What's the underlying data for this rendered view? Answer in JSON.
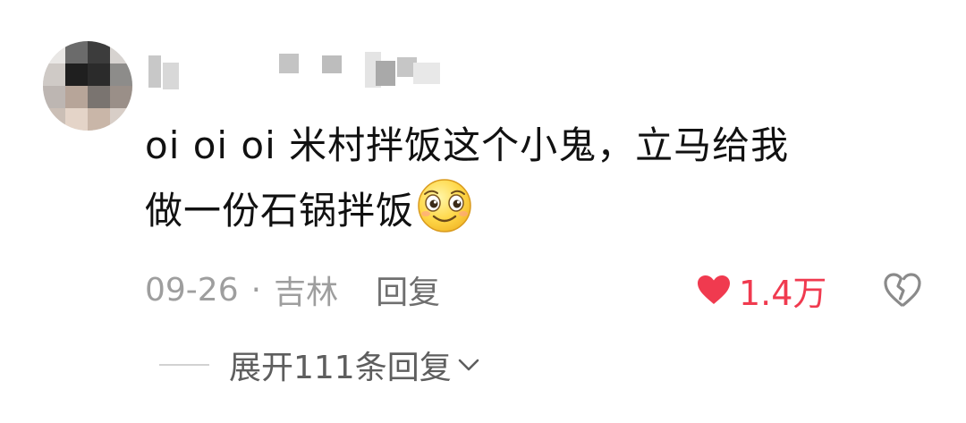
{
  "comment": {
    "username": "",
    "text_line1": "oi oi oi 米村拌饭这个小鬼，立马给我",
    "text_line2": "做一份石锅拌饭",
    "emoji_icon": "smiling-face-emoji-icon",
    "date": "09-26",
    "separator": "·",
    "location": "吉林",
    "reply_label": "回复",
    "like_count": "1.4万",
    "like_color": "#f03a4f",
    "liked": true,
    "expand_label": "展开111条回复"
  }
}
